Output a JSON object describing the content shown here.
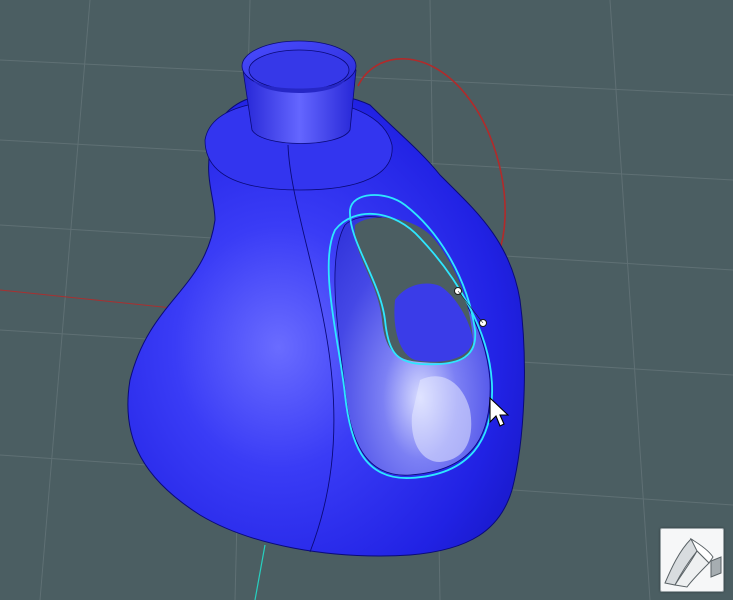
{
  "viewport": {
    "view": "perspective",
    "background_color": "#4b5e62",
    "grid_color": "#5f7074",
    "axis_x_color": "#a83030",
    "axis_y_color": "#26d0c0"
  },
  "model": {
    "object": "bottle-surface",
    "surface_color": "#2a2cf2",
    "edge_color": "#0a0a78",
    "selection_color": "#2ee6ff",
    "trim_curve_color": "#b22a2a",
    "control_points": 2
  },
  "cursor": {
    "icon": "arrow-cursor-icon"
  },
  "tool_panel": {
    "icon": "surface-tool-icon",
    "bg_color": "#f6f7f8"
  }
}
